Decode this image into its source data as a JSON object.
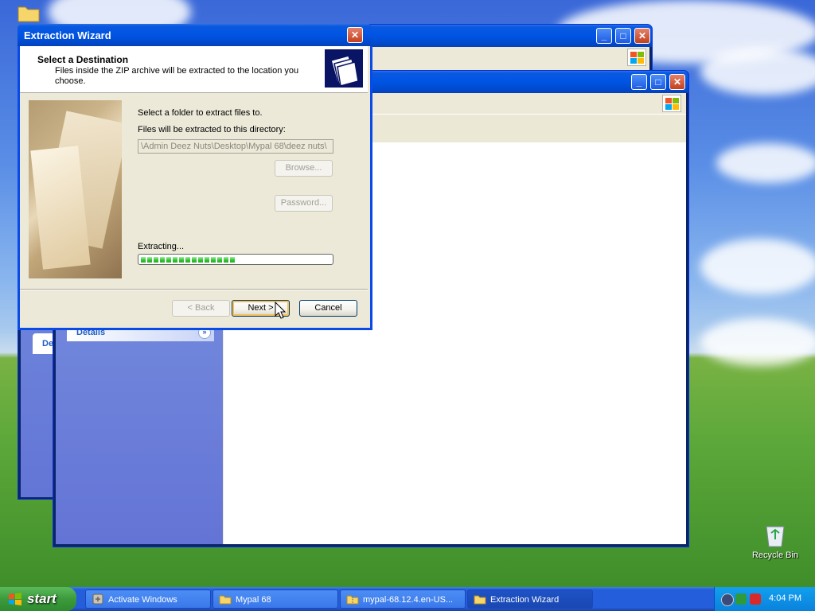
{
  "desktop": {
    "top_left_icon": {
      "label": ""
    },
    "recycle_bin": {
      "label": "Recycle Bin"
    }
  },
  "bg_window_1": {
    "title": ""
  },
  "bg_window_2": {
    "title": "",
    "details_label": "Details",
    "left_tab_fragment": "De"
  },
  "wizard": {
    "title": "Extraction Wizard",
    "header_title": "Select a Destination",
    "header_subtitle": "Files inside the ZIP archive will be extracted to the location you choose.",
    "select_folder_label": "Select a folder to extract files to.",
    "directory_label": "Files will be extracted to this directory:",
    "directory_value": "\\Admin Deez Nuts\\Desktop\\Mypal 68\\deez nuts\\",
    "browse_label": "Browse...",
    "password_label": "Password...",
    "progress_label": "Extracting...",
    "progress_fraction": 0.53,
    "back_label": "< Back",
    "next_label": "Next >",
    "cancel_label": "Cancel"
  },
  "taskbar": {
    "start_label": "start",
    "items": [
      {
        "label": "Activate Windows",
        "icon": "activate-windows-icon"
      },
      {
        "label": "Mypal 68",
        "icon": "folder-icon"
      },
      {
        "label": "mypal-68.12.4.en-US...",
        "icon": "zip-folder-icon"
      },
      {
        "label": "Extraction Wizard",
        "icon": "folder-icon"
      }
    ],
    "clock": "4:04 PM"
  },
  "colors": {
    "title_bar": "#0054e3",
    "dialog_face": "#ece9d8",
    "start_button": "#3c9a3c",
    "taskbar": "#245edb",
    "progress": "#2ec22e"
  }
}
